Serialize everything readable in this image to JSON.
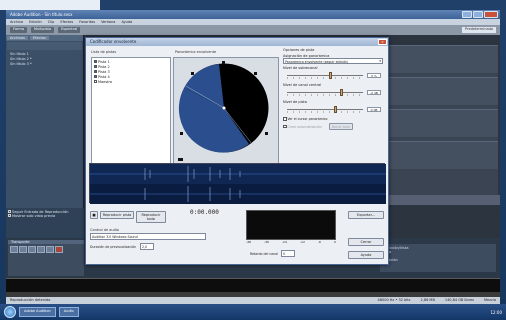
{
  "app": {
    "title": "Adobe Audition - Sin título.sesx",
    "menu": [
      "Archivo",
      "Edición",
      "Clip",
      "Efectos",
      "Favoritos",
      "Ventana",
      "Ayuda"
    ],
    "toolbar": [
      "Forma",
      "Multipista",
      "Espectral"
    ],
    "workspace": "Predeterminado"
  },
  "left_panel": {
    "tabs": [
      "Archivos",
      "Efectos"
    ],
    "files": [
      "Sin título 1",
      "Sin título 2 *",
      "Sin título 3 *"
    ],
    "bottom_checks": [
      "Seguir Entrada de Reproducción",
      "Mostrar solo vista previa"
    ]
  },
  "transport": {
    "title": "Transporte",
    "buttons": [
      "stop",
      "play",
      "pause",
      "rewind",
      "fast-forward",
      "record"
    ]
  },
  "selection_view": {
    "title": "Selección/Vista",
    "rows": [
      "Inicio",
      "Fin",
      "Duración"
    ]
  },
  "status_bar": {
    "left": "Reproducción detenida",
    "items": [
      "48000 Hz • 32 bits",
      "2,86 MB",
      "140,84 GB libres",
      "Mezcla"
    ]
  },
  "taskbar": {
    "items": [
      "Adobe Audition",
      "Audio"
    ],
    "clock": "12:00"
  },
  "dialog": {
    "title": "Codificador envolvente",
    "channels_label": "Lista de pistas",
    "channels": [
      {
        "label": "Pista 1",
        "checked": true
      },
      {
        "label": "Pista 2",
        "checked": true
      },
      {
        "label": "Pista 3",
        "checked": true
      },
      {
        "label": "Pista 4",
        "checked": true
      },
      {
        "label": "Maestro",
        "checked": false
      }
    ],
    "pan_label": "Panorámica envolvente",
    "options_label": "Opciones de pista",
    "pan_select_label": "Asignación de panorámica",
    "pan_select_value": "Panorámica envolvente (seguir edición)",
    "sliders": [
      {
        "label": "Nivel de sobrecanal",
        "value": "0 %",
        "fraction": 0.55
      },
      {
        "label": "Nivel de canal central",
        "value": "-2 dB",
        "fraction": 0.7
      },
      {
        "label": "Nivel de pista",
        "value": "0 dB",
        "fraction": 0.62
      }
    ],
    "checkbox_1": "Ver el cursor panorámico",
    "checkbox_2": "Crear automatización",
    "small_button": "Borrar todo",
    "play_button": "Reproducir pista",
    "play_all_button": "Reproducir todo",
    "timecode": "0:00.000",
    "export_button": "Exportar...",
    "audio_control_label": "Control de audio",
    "audio_device": "Audition 3.0 Windows Sound",
    "loop_label": "Duración de previsualización",
    "loop_value": "2,0",
    "delay_label": "Retardo del canal",
    "delay_value": "0",
    "ok_button": "Cerrar",
    "cancel_button": "Ayuda",
    "meter_scale": [
      "-48",
      "-36",
      "-24",
      "-12",
      "-6",
      "0"
    ]
  }
}
